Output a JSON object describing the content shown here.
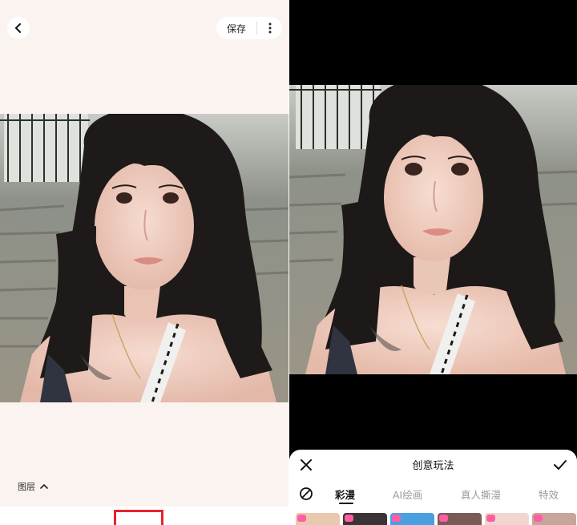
{
  "left_screen": {
    "header": {
      "back_icon": "chevron-left-icon",
      "save_label": "保存",
      "more_icon": "more-vertical-icon"
    },
    "photo": {
      "subject": "selfie-photo"
    },
    "layers": {
      "label": "图层",
      "toggle_icon": "chevron-up-icon"
    },
    "toolbar": {
      "highlight_color": "#e8232d"
    }
  },
  "right_screen": {
    "photo": {
      "subject": "selfie-photo-preview"
    },
    "panel": {
      "title": "创意玩法",
      "close_icon": "close-icon",
      "confirm_icon": "check-icon",
      "none_icon": "no-effect-icon",
      "tabs": [
        {
          "label": "彩漫",
          "active": true
        },
        {
          "label": "AI绘画",
          "active": false
        },
        {
          "label": "真人撕漫",
          "active": false
        },
        {
          "label": "特效",
          "active": false
        }
      ],
      "thumbnail_count": 6
    }
  },
  "colors": {
    "left_background": "#fbf3ef",
    "accent_pink": "#ff5fa2",
    "highlight_red": "#e8232d"
  }
}
